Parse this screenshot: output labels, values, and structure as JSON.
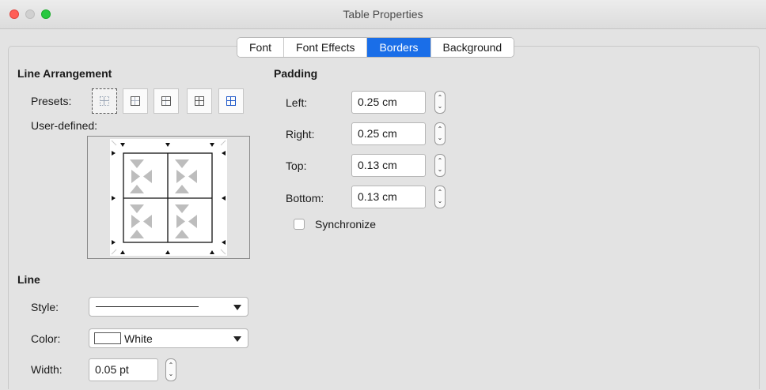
{
  "window": {
    "title": "Table Properties"
  },
  "tabs": [
    "Font",
    "Font Effects",
    "Borders",
    "Background"
  ],
  "active_tab": "Borders",
  "line_arrangement": {
    "heading": "Line Arrangement",
    "presets_label": "Presets:",
    "user_defined_label": "User-defined:"
  },
  "padding": {
    "heading": "Padding",
    "left_label": "Left:",
    "left_value": "0.25 cm",
    "right_label": "Right:",
    "right_value": "0.25 cm",
    "top_label": "Top:",
    "top_value": "0.13 cm",
    "bottom_label": "Bottom:",
    "bottom_value": "0.13 cm",
    "synchronize_label": "Synchronize",
    "synchronize_checked": false
  },
  "line": {
    "heading": "Line",
    "style_label": "Style:",
    "color_label": "Color:",
    "color_value": "White",
    "color_swatch": "#ffffff",
    "width_label": "Width:",
    "width_value": "0.05 pt"
  },
  "colors": {
    "accent": "#1a6ee8",
    "background": "#e3e3e3"
  }
}
